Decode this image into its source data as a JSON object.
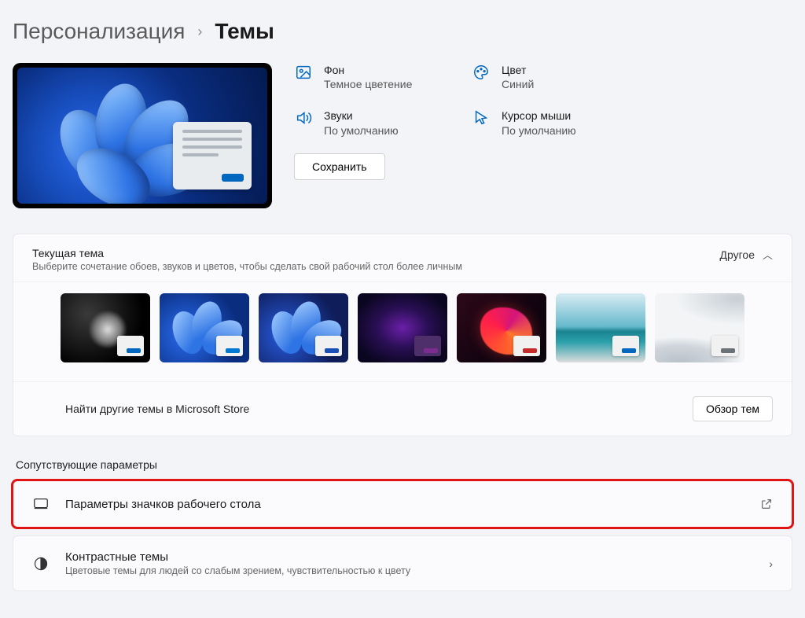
{
  "breadcrumb": {
    "parent": "Персонализация",
    "current": "Темы"
  },
  "theme_props": {
    "background": {
      "label": "Фон",
      "value": "Темное цветение"
    },
    "color": {
      "label": "Цвет",
      "value": "Синий"
    },
    "sounds": {
      "label": "Звуки",
      "value": "По умолчанию"
    },
    "cursor": {
      "label": "Курсор мыши",
      "value": "По умолчанию"
    }
  },
  "save_button": "Сохранить",
  "current_theme": {
    "title": "Текущая тема",
    "subtitle": "Выберите сочетание обоев, звуков и цветов, чтобы сделать свой рабочий стол более личным",
    "collapse_label": "Другое",
    "thumbs": [
      {
        "accent": "#0067c0"
      },
      {
        "accent": "#0078d4"
      },
      {
        "accent": "#1b4fb8"
      },
      {
        "accent": "#7a2d8f"
      },
      {
        "accent": "#c42b2b"
      },
      {
        "accent": "#0067c0"
      },
      {
        "accent": "#6b7178"
      }
    ],
    "store_text": "Найти другие темы в Microsoft Store",
    "browse_button": "Обзор тем"
  },
  "related": {
    "section_label": "Сопутствующие параметры",
    "desktop_icons": {
      "title": "Параметры значков рабочего стола"
    },
    "contrast": {
      "title": "Контрастные темы",
      "subtitle": "Цветовые темы для людей со слабым зрением, чувствительностью к цвету"
    }
  }
}
